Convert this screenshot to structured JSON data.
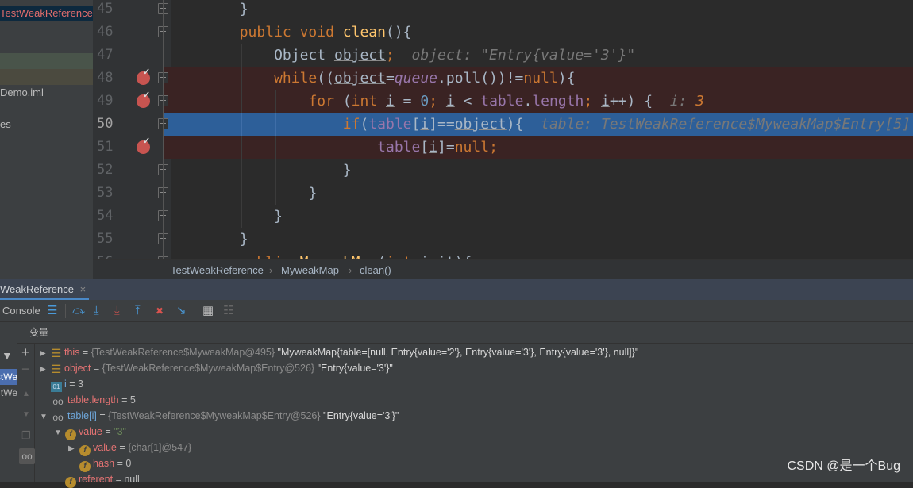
{
  "project_panel": {
    "items": [
      {
        "label": "TestWeakReference",
        "style": "selected"
      },
      {
        "label": "",
        "style": "green"
      },
      {
        "label": "",
        "style": "brown"
      },
      {
        "label": "Demo.iml",
        "style": "normal"
      },
      {
        "label": "es",
        "style": "normal"
      }
    ]
  },
  "editor": {
    "current_line": 50,
    "lines": [
      {
        "num": "45",
        "indent": 8,
        "tokens": [
          {
            "t": "}",
            "c": ""
          }
        ]
      },
      {
        "num": "46",
        "indent": 8,
        "tokens": [
          {
            "t": "public void ",
            "c": "kw"
          },
          {
            "t": "clean",
            "c": "fn"
          },
          {
            "t": "(){",
            "c": ""
          }
        ]
      },
      {
        "num": "47",
        "indent": 12,
        "tokens": [
          {
            "t": "Object ",
            "c": ""
          },
          {
            "t": "object",
            "c": "ul"
          },
          {
            "t": ";",
            "c": "kw"
          },
          {
            "t": "  object: \"Entry{value='3'}\"",
            "c": "hint"
          }
        ]
      },
      {
        "num": "48",
        "indent": 12,
        "breakpoint": true,
        "tokens": [
          {
            "t": "while",
            "c": "kw"
          },
          {
            "t": "((",
            "c": ""
          },
          {
            "t": "object",
            "c": "ul"
          },
          {
            "t": "=",
            "c": ""
          },
          {
            "t": "queue",
            "c": "it"
          },
          {
            "t": ".poll())!=",
            "c": ""
          },
          {
            "t": "null",
            "c": "kw"
          },
          {
            "t": "){",
            "c": ""
          }
        ]
      },
      {
        "num": "49",
        "indent": 16,
        "breakpoint": true,
        "tokens": [
          {
            "t": "for ",
            "c": "kw"
          },
          {
            "t": "(",
            "c": ""
          },
          {
            "t": "int ",
            "c": "kw"
          },
          {
            "t": "i",
            "c": "ul"
          },
          {
            "t": " = ",
            "c": ""
          },
          {
            "t": "0",
            "c": "num"
          },
          {
            "t": "; ",
            "c": "kw"
          },
          {
            "t": "i",
            "c": "ul"
          },
          {
            "t": " < ",
            "c": ""
          },
          {
            "t": "table",
            "c": "fld"
          },
          {
            "t": ".",
            "c": ""
          },
          {
            "t": "length",
            "c": "fld"
          },
          {
            "t": "; ",
            "c": "kw"
          },
          {
            "t": "i",
            "c": "ul"
          },
          {
            "t": "++) {  ",
            "c": ""
          },
          {
            "t": "i: ",
            "c": "hint"
          },
          {
            "t": "3",
            "c": "hintn"
          }
        ]
      },
      {
        "num": "50",
        "indent": 20,
        "tokens": [
          {
            "t": "if",
            "c": "kw"
          },
          {
            "t": "(",
            "c": ""
          },
          {
            "t": "table",
            "c": "fld"
          },
          {
            "t": "[",
            "c": ""
          },
          {
            "t": "i",
            "c": "ul"
          },
          {
            "t": "]==",
            "c": ""
          },
          {
            "t": "object",
            "c": "ul"
          },
          {
            "t": "){  ",
            "c": ""
          },
          {
            "t": "table: TestWeakReference$MyweakMap$Entry[5]",
            "c": "hint"
          }
        ]
      },
      {
        "num": "51",
        "indent": 24,
        "breakpoint": true,
        "tokens": [
          {
            "t": "table",
            "c": "fld"
          },
          {
            "t": "[",
            "c": ""
          },
          {
            "t": "i",
            "c": "ul"
          },
          {
            "t": "]=",
            "c": ""
          },
          {
            "t": "null",
            "c": "kw"
          },
          {
            "t": ";",
            "c": "kw"
          }
        ]
      },
      {
        "num": "52",
        "indent": 20,
        "tokens": [
          {
            "t": "}",
            "c": ""
          }
        ]
      },
      {
        "num": "53",
        "indent": 16,
        "tokens": [
          {
            "t": "}",
            "c": ""
          }
        ]
      },
      {
        "num": "54",
        "indent": 12,
        "tokens": [
          {
            "t": "}",
            "c": ""
          }
        ]
      },
      {
        "num": "55",
        "indent": 8,
        "tokens": [
          {
            "t": "}",
            "c": ""
          }
        ]
      },
      {
        "num": "56",
        "indent": 8,
        "tokens": [
          {
            "t": "public ",
            "c": "kw"
          },
          {
            "t": "MyweakMap",
            "c": "fn"
          },
          {
            "t": "(",
            "c": ""
          },
          {
            "t": "int ",
            "c": "kw"
          },
          {
            "t": "init",
            "c": ""
          },
          {
            "t": "){",
            "c": ""
          }
        ]
      }
    ]
  },
  "breadcrumb": [
    "TestWeakReference",
    "MyweakMap",
    "clean()"
  ],
  "debug": {
    "tab_label": "WeakReference",
    "console_label": "Console",
    "variables_header": "变量",
    "toolbar_icons": [
      "show-execution-point-icon",
      "step-over-icon",
      "step-into-icon",
      "force-step-into-icon",
      "step-out-icon",
      "drop-frame-icon",
      "run-to-cursor-icon",
      "evaluate-expression-icon",
      "trace-icon"
    ],
    "frames": [
      "stWe",
      "tWe"
    ],
    "variables": [
      {
        "depth": 0,
        "arrow": "right",
        "icon": "obj",
        "name": "this",
        "kind": "field",
        "value": "{TestWeakReference$MyweakMap@495}",
        "str": "\"MyweakMap{table=[null, Entry{value='2'}, Entry{value='3'}, Entry{value='3'}, null]}\""
      },
      {
        "depth": 0,
        "arrow": "right",
        "icon": "obj",
        "name": "object",
        "kind": "field",
        "value": "{TestWeakReference$MyweakMap$Entry@526}",
        "str": "\"Entry{value='3'}\""
      },
      {
        "depth": 0,
        "arrow": "",
        "icon": "prim",
        "name": "i",
        "kind": "local",
        "plain": "3"
      },
      {
        "depth": 0,
        "arrow": "",
        "icon": "watch",
        "name": "table.length",
        "kind": "field",
        "plain": "5"
      },
      {
        "depth": 0,
        "arrow": "down",
        "icon": "watch",
        "name": "table[i]",
        "kind": "local",
        "value": "{TestWeakReference$MyweakMap$Entry@526}",
        "str": "\"Entry{value='3'}\""
      },
      {
        "depth": 1,
        "arrow": "down",
        "icon": "f",
        "name": "value",
        "kind": "field",
        "strg": "\"3\""
      },
      {
        "depth": 2,
        "arrow": "right",
        "icon": "f",
        "name": "value",
        "kind": "field",
        "value": "{char[1]@547}"
      },
      {
        "depth": 2,
        "arrow": "",
        "icon": "f",
        "name": "hash",
        "kind": "field",
        "plain": "0"
      },
      {
        "depth": 1,
        "arrow": "",
        "icon": "f",
        "name": "referent",
        "kind": "field",
        "plain": "null"
      }
    ]
  },
  "watermark": "CSDN @是一个Bug",
  "colors": {
    "breakpoint_line": "#3a2323",
    "execution_line": "#2d5f99",
    "background": "#2b2b2b",
    "keyword": "#cc7832"
  }
}
